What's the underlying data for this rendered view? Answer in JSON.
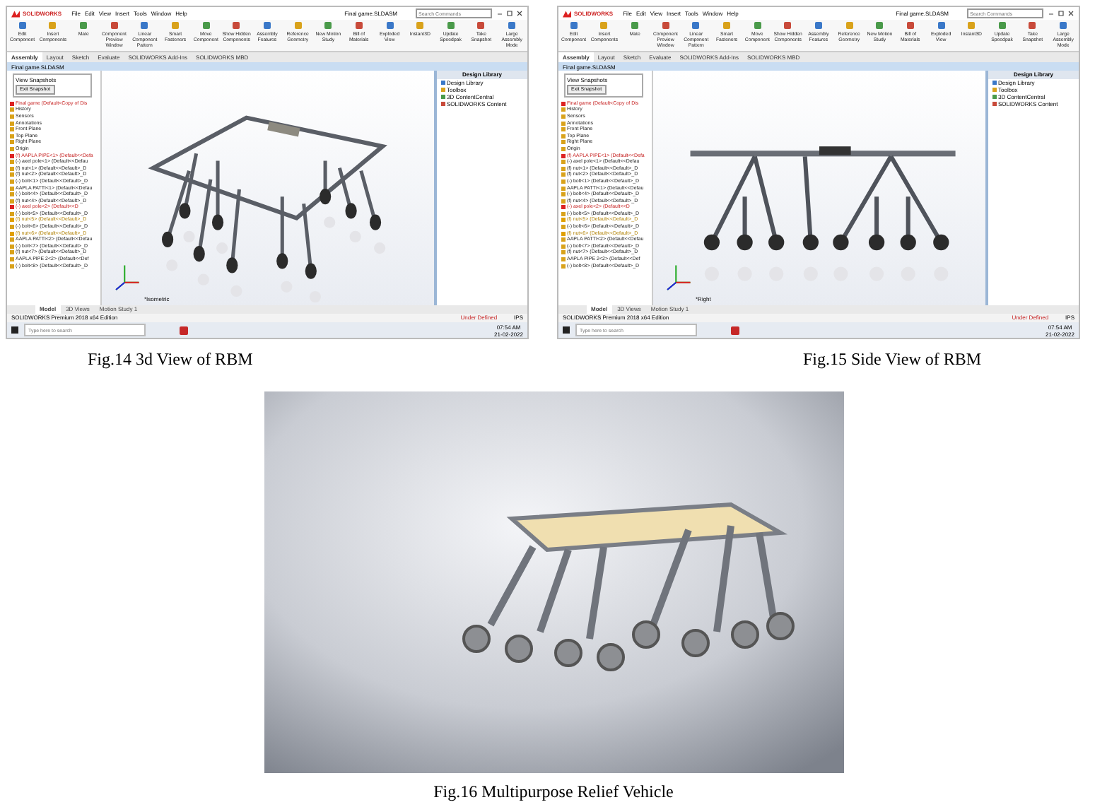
{
  "figures": [
    {
      "kind": "cad_screenshot",
      "model": {
        "kind": "isometric"
      },
      "caption": "Fig.14 3d View of RBM",
      "app": {
        "logo": "SOLIDWORKS",
        "menus": [
          "File",
          "Edit",
          "View",
          "Insert",
          "Tools",
          "Window",
          "Help"
        ],
        "title": "Final game.SLDASM",
        "search": {
          "placeholder": "Search Commands"
        },
        "ribbon": [
          "Edit Component",
          "Insert Components",
          "Mate",
          "Component Preview Window",
          "Linear Component Pattern",
          "Smart Fasteners",
          "Move Component",
          "Show Hidden Components",
          "Assembly Features",
          "Reference Geometry",
          "New Motion Study",
          "Bill of Materials",
          "Exploded View",
          "Instant3D",
          "Update Speedpak",
          "Take Snapshot",
          "Large Assembly Mode"
        ],
        "tabs": [
          {
            "label": "Assembly",
            "selected": true
          },
          {
            "label": "Layout",
            "selected": false
          },
          {
            "label": "Sketch",
            "selected": false
          },
          {
            "label": "Evaluate",
            "selected": false
          },
          {
            "label": "SOLIDWORKS Add-Ins",
            "selected": false
          },
          {
            "label": "SOLIDWORKS MBD",
            "selected": false
          }
        ],
        "document": "Final game.SLDASM",
        "snapshot": {
          "title": "View Snapshots",
          "button": "Exit Snapshot"
        },
        "tree": [
          {
            "label": "Final game  (Default<Copy of Dis",
            "kind": "error"
          },
          {
            "label": "History",
            "kind": "normal"
          },
          {
            "label": "Sensors",
            "kind": "normal"
          },
          {
            "label": "Annotations",
            "kind": "normal"
          },
          {
            "label": "Front Plane",
            "kind": "normal"
          },
          {
            "label": "Top Plane",
            "kind": "normal"
          },
          {
            "label": "Right Plane",
            "kind": "normal"
          },
          {
            "label": "Origin",
            "kind": "normal"
          },
          {
            "label": "(f) AAPLA PIPE<1> (Default<<Defa",
            "kind": "error"
          },
          {
            "label": "(-) axel pole<1> (Default<<Defau",
            "kind": "normal"
          },
          {
            "label": "(f) nut<1> (Default<<Default>_D",
            "kind": "normal"
          },
          {
            "label": "(f) nut<2> (Default<<Default>_D",
            "kind": "normal"
          },
          {
            "label": "(-) bolt<1> (Default<<Default>_D",
            "kind": "normal"
          },
          {
            "label": "AAPLA PATTI<1> (Default<<Defau",
            "kind": "normal"
          },
          {
            "label": "(-) bolt<4> (Default<<Default>_D",
            "kind": "normal"
          },
          {
            "label": "(f) nut<4> (Default<<Default>_D",
            "kind": "normal"
          },
          {
            "label": "(-) axel pole<2> (Default<<D",
            "kind": "error"
          },
          {
            "label": "(-) bolt<5> (Default<<Default>_D",
            "kind": "normal"
          },
          {
            "label": "(f) nut<5> (Default<<Default>_D",
            "kind": "warning"
          },
          {
            "label": "(-) bolt<6> (Default<<Default>_D",
            "kind": "normal"
          },
          {
            "label": "(f) nut<6> (Default<<Default>_D",
            "kind": "warning"
          },
          {
            "label": "AAPLA PATTI<2> (Default<<Defau",
            "kind": "normal"
          },
          {
            "label": "(-) bolt<7> (Default<<Default>_D",
            "kind": "normal"
          },
          {
            "label": "(f) nut<7> (Default<<Default>_D",
            "kind": "normal"
          },
          {
            "label": "AAPLA PIPE 2<2> (Default<<Def",
            "kind": "normal"
          },
          {
            "label": "(-) bolt<8> (Default<<Default>_D",
            "kind": "normal"
          }
        ],
        "view_label": "*Isometric",
        "library": {
          "title": "Design Library",
          "items": [
            "Design Library",
            "Toolbox",
            "3D ContentCentral",
            "SOLIDWORKS Content"
          ]
        },
        "model_tabs": [
          {
            "label": "Model",
            "selected": true
          },
          {
            "label": "3D Views",
            "selected": false
          },
          {
            "label": "Motion Study 1",
            "selected": false
          }
        ],
        "status": "SOLIDWORKS Premium 2018 x64 Edition",
        "status_right": [
          "Under Defined",
          "IPS"
        ],
        "taskbar": {
          "search": {
            "placeholder": "Type here to search"
          },
          "time": "07:54 AM",
          "date": "21-02-2022"
        }
      }
    },
    {
      "kind": "cad_screenshot",
      "model": {
        "kind": "side"
      },
      "caption": "Fig.15 Side View of RBM",
      "app": {
        "logo": "SOLIDWORKS",
        "menus": [
          "File",
          "Edit",
          "View",
          "Insert",
          "Tools",
          "Window",
          "Help"
        ],
        "title": "Final game.SLDASM",
        "search": {
          "placeholder": "Search Commands"
        },
        "ribbon": [
          "Edit Component",
          "Insert Components",
          "Mate",
          "Component Preview Window",
          "Linear Component Pattern",
          "Smart Fasteners",
          "Move Component",
          "Show Hidden Components",
          "Assembly Features",
          "Reference Geometry",
          "New Motion Study",
          "Bill of Materials",
          "Exploded View",
          "Instant3D",
          "Update Speedpak",
          "Take Snapshot",
          "Large Assembly Mode"
        ],
        "tabs": [
          {
            "label": "Assembly",
            "selected": true
          },
          {
            "label": "Layout",
            "selected": false
          },
          {
            "label": "Sketch",
            "selected": false
          },
          {
            "label": "Evaluate",
            "selected": false
          },
          {
            "label": "SOLIDWORKS Add-Ins",
            "selected": false
          },
          {
            "label": "SOLIDWORKS MBD",
            "selected": false
          }
        ],
        "document": "Final game.SLDASM",
        "snapshot": {
          "title": "View Snapshots",
          "button": "Exit Snapshot"
        },
        "tree": [
          {
            "label": "Final game  (Default<Copy of Dis",
            "kind": "error"
          },
          {
            "label": "History",
            "kind": "normal"
          },
          {
            "label": "Sensors",
            "kind": "normal"
          },
          {
            "label": "Annotations",
            "kind": "normal"
          },
          {
            "label": "Front Plane",
            "kind": "normal"
          },
          {
            "label": "Top Plane",
            "kind": "normal"
          },
          {
            "label": "Right Plane",
            "kind": "normal"
          },
          {
            "label": "Origin",
            "kind": "normal"
          },
          {
            "label": "(f) AAPLA PIPE<1> (Default<<Defa",
            "kind": "error"
          },
          {
            "label": "(-) axel pole<1> (Default<<Defau",
            "kind": "normal"
          },
          {
            "label": "(f) nut<1> (Default<<Default>_D",
            "kind": "normal"
          },
          {
            "label": "(f) nut<2> (Default<<Default>_D",
            "kind": "normal"
          },
          {
            "label": "(-) bolt<1> (Default<<Default>_D",
            "kind": "normal"
          },
          {
            "label": "AAPLA PATTI<1> (Default<<Defau",
            "kind": "normal"
          },
          {
            "label": "(-) bolt<4> (Default<<Default>_D",
            "kind": "normal"
          },
          {
            "label": "(f) nut<4> (Default<<Default>_D",
            "kind": "normal"
          },
          {
            "label": "(-) axel pole<2> (Default<<D",
            "kind": "error"
          },
          {
            "label": "(-) bolt<5> (Default<<Default>_D",
            "kind": "normal"
          },
          {
            "label": "(f) nut<5> (Default<<Default>_D",
            "kind": "warning"
          },
          {
            "label": "(-) bolt<6> (Default<<Default>_D",
            "kind": "normal"
          },
          {
            "label": "(f) nut<6> (Default<<Default>_D",
            "kind": "warning"
          },
          {
            "label": "AAPLA PATTI<2> (Default<<Defau",
            "kind": "normal"
          },
          {
            "label": "(-) bolt<7> (Default<<Default>_D",
            "kind": "normal"
          },
          {
            "label": "(f) nut<7> (Default<<Default>_D",
            "kind": "normal"
          },
          {
            "label": "AAPLA PIPE 2<2> (Default<<Def",
            "kind": "normal"
          },
          {
            "label": "(-) bolt<8> (Default<<Default>_D",
            "kind": "normal"
          }
        ],
        "view_label": "*Right",
        "library": {
          "title": "Design Library",
          "items": [
            "Design Library",
            "Toolbox",
            "3D ContentCentral",
            "SOLIDWORKS Content"
          ]
        },
        "model_tabs": [
          {
            "label": "Model",
            "selected": true
          },
          {
            "label": "3D Views",
            "selected": false
          },
          {
            "label": "Motion Study 1",
            "selected": false
          }
        ],
        "status": "SOLIDWORKS Premium 2018 x64 Edition",
        "status_right": [
          "Under Defined",
          "IPS"
        ],
        "taskbar": {
          "search": {
            "placeholder": "Type here to search"
          },
          "time": "07:54 AM",
          "date": "21-02-2022"
        }
      }
    },
    {
      "kind": "render",
      "caption": "Fig.16 Multipurpose Relief Vehicle"
    }
  ]
}
